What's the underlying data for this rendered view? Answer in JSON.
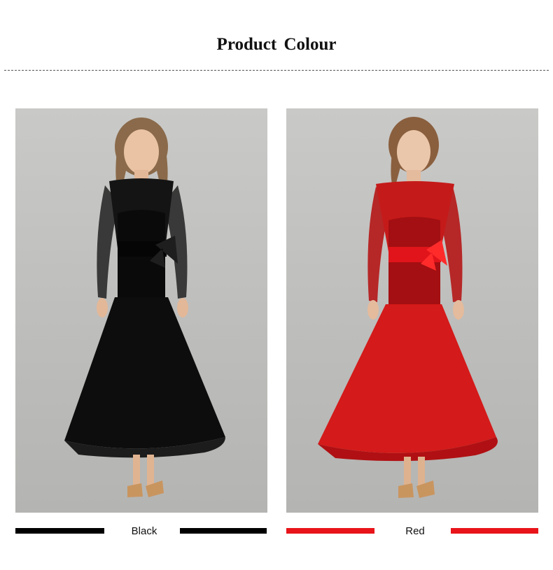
{
  "header": {
    "title": "Product  Colour"
  },
  "products": [
    {
      "color_name": "Black",
      "swatch_color": "#000000",
      "dress_color": "#0d0d0d"
    },
    {
      "color_name": "Red",
      "swatch_color": "#e8141a",
      "dress_color": "#d41a1a"
    }
  ]
}
